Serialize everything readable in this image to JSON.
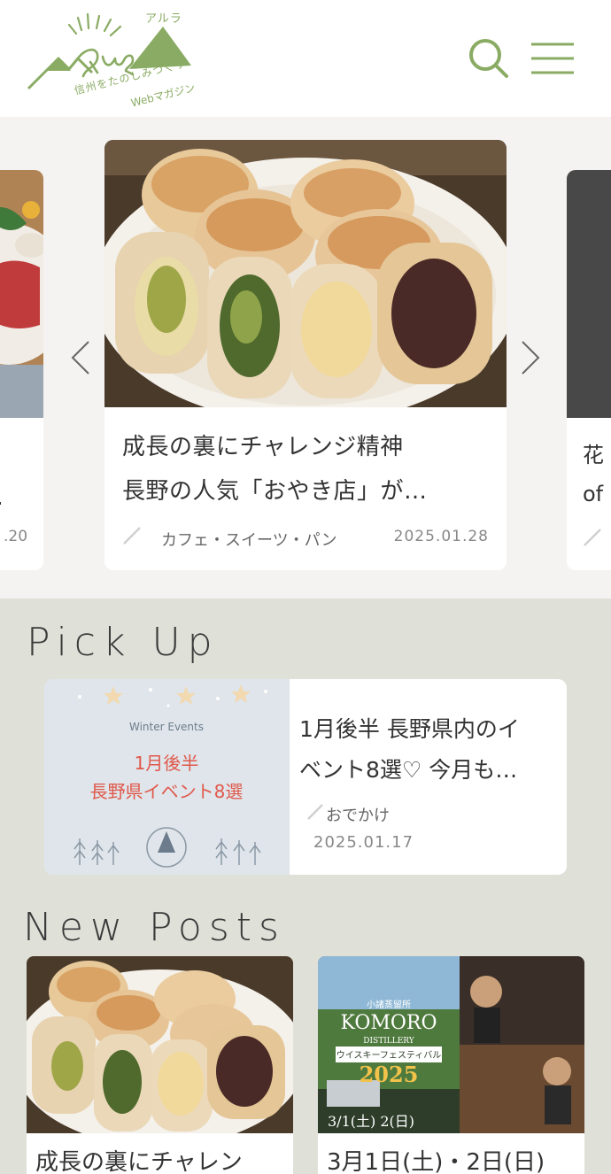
{
  "header": {
    "logo_text": "ARURA",
    "logo_kana": "アルラ",
    "logo_tagline_1": "信州をたのしみつくす",
    "logo_tagline_2": "Webマガジン",
    "search_icon": "search-icon",
    "menu_icon": "hamburger-menu-icon"
  },
  "colors": {
    "brand_green": "#8aab63",
    "slider_bg": "#f5f3f1",
    "page_bg": "#dfe0d8",
    "pickup_accent": "#e0584b"
  },
  "slider": {
    "main": {
      "title_line1": "成長の裏にチャレンジ精神",
      "title_line2": "長野の人気「おやき店」が…",
      "category": "カフェ・スイーツ・パン",
      "date": "2025.01.28"
    },
    "left": {
      "text_fragment": ".",
      "date_fragment": ".20"
    },
    "right": {
      "text_fragment_1": "花",
      "text_fragment_2": "of"
    },
    "prev_icon": "chevron-left-icon",
    "next_icon": "chevron-right-icon"
  },
  "pickup": {
    "heading": "Pick Up",
    "card": {
      "image_caption_en": "Winter Events",
      "image_caption_1": "1月後半",
      "image_caption_2": "長野県イベント8選",
      "title_line1": "1月後半 長野県内のイ",
      "title_line2": "ベント8選♡ 今月も…",
      "category": "おでかけ",
      "date": "2025.01.17"
    }
  },
  "new_posts": {
    "heading": "New Posts",
    "items": [
      {
        "title": "成長の裏にチャレン"
      },
      {
        "title": "3月1日(土)・2日(日)",
        "image_text_1": "小諸蒸留所",
        "image_text_2": "KOMORO",
        "image_text_3": "DISTILLERY",
        "image_text_4": "ウイスキーフェスティバル",
        "image_text_5": "2025",
        "image_text_6": "3/1(土) 2(日)"
      }
    ]
  }
}
